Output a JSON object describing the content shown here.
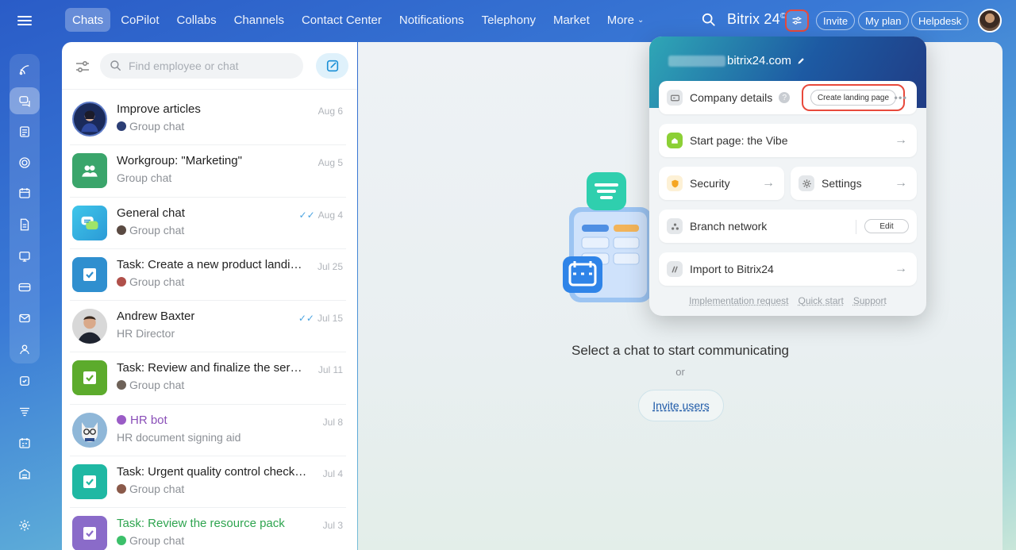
{
  "topnav": {
    "tabs": [
      "Chats",
      "CoPilot",
      "Collabs",
      "Channels",
      "Contact Center",
      "Notifications",
      "Telephony",
      "Market"
    ],
    "more_label": "More",
    "brand": "Bitrix 24",
    "brand_mark": "©",
    "invite_label": "Invite",
    "plan_label": "My plan",
    "helpdesk_label": "Helpdesk"
  },
  "chatpanel": {
    "search_placeholder": "Find employee or chat",
    "items": [
      {
        "title": "Improve articles",
        "sub": "Group chat",
        "date": "Aug 6"
      },
      {
        "title": "Workgroup: \"Marketing\"",
        "sub": "Group chat",
        "date": "Aug 5"
      },
      {
        "title": "General chat",
        "sub": "Group chat",
        "date": "Aug 4"
      },
      {
        "title": "Task: Create a new product landing...",
        "sub": "Group chat",
        "date": "Jul 25"
      },
      {
        "title": "Andrew Baxter",
        "sub": "HR Director",
        "date": "Jul 15"
      },
      {
        "title": "Task: Review and finalize the servic...",
        "sub": "Group chat",
        "date": "Jul 11"
      },
      {
        "title": "HR bot",
        "sub": "HR document signing aid",
        "date": "Jul 8"
      },
      {
        "title": "Task: Urgent quality control check re...",
        "sub": "Group chat",
        "date": "Jul 4"
      },
      {
        "title": "Task: Review the resource pack",
        "sub": "Group chat",
        "date": "Jul 3"
      }
    ]
  },
  "main": {
    "empty_title": "Select a chat to start communicating",
    "or_label": "or",
    "invite_users": "Invite users"
  },
  "popup": {
    "domain_suffix": "bitrix24.com",
    "company_details": "Company details",
    "create_landing": "Create landing page",
    "start_page": "Start page: the Vibe",
    "security": "Security",
    "settings": "Settings",
    "branch_network": "Branch network",
    "edit_label": "Edit",
    "import": "Import to Bitrix24",
    "footer": [
      "Implementation request",
      "Quick start",
      "Support"
    ]
  },
  "colors": {
    "accent": "#2fa7b6",
    "highlight": "#e8493b",
    "task_green": "#5cab2c",
    "task_teal": "#1fb8a3"
  }
}
